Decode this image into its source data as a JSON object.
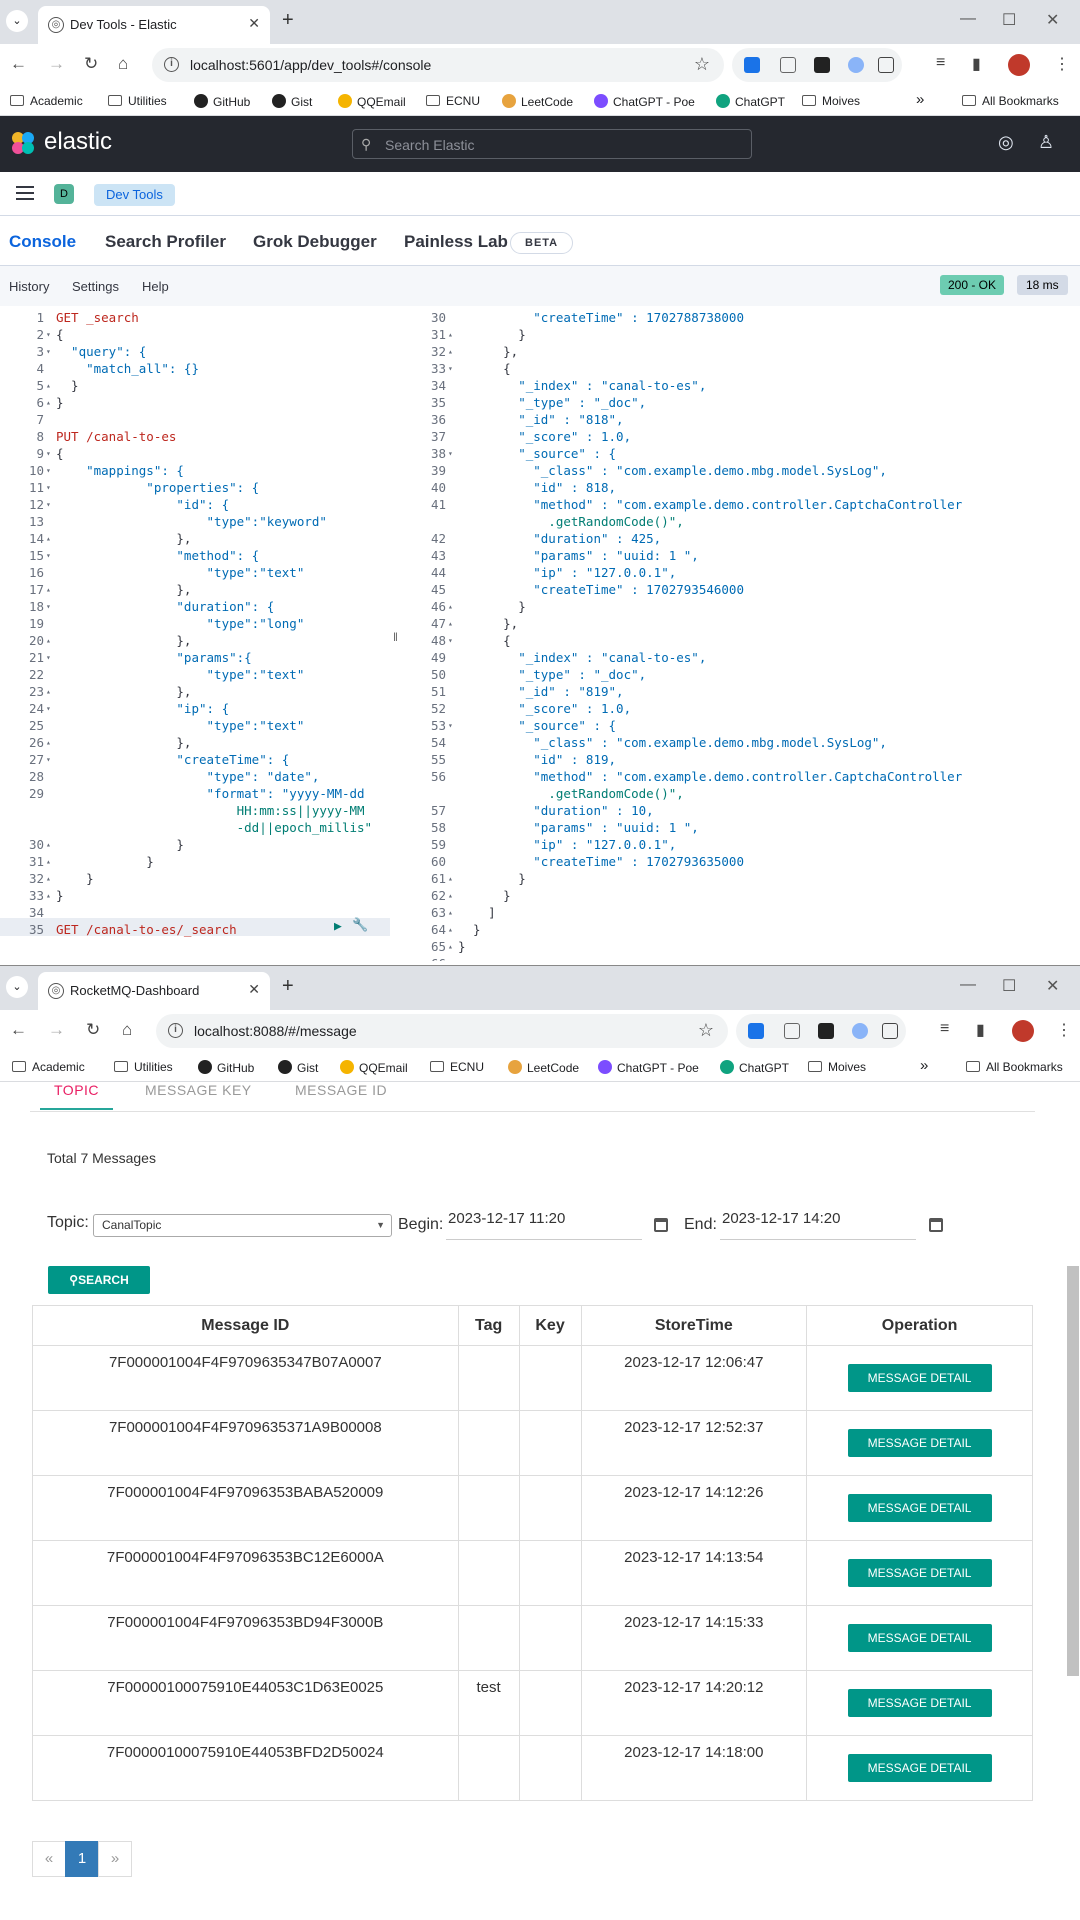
{
  "browser1": {
    "tab_title": "Dev Tools - Elastic",
    "url": "localhost:5601/app/dev_tools#/console"
  },
  "browser2": {
    "tab_title": "RocketMQ-Dashboard",
    "url": "localhost:8088/#/message"
  },
  "bookmarks": [
    "Academic",
    "Utilities",
    "GitHub",
    "Gist",
    "QQEmail",
    "ECNU",
    "LeetCode",
    "ChatGPT - Poe",
    "ChatGPT",
    "Moives"
  ],
  "bookmarks_more": "»",
  "all_bookmarks": "All Bookmarks",
  "kibana": {
    "brand": "elastic",
    "search_placeholder": "Search Elastic",
    "space_initial": "D",
    "breadcrumb": "Dev Tools",
    "tabs": [
      "Console",
      "Search Profiler",
      "Grok Debugger",
      "Painless Lab"
    ],
    "beta": "BETA",
    "menu": [
      "History",
      "Settings",
      "Help"
    ],
    "status": "200 - OK",
    "time": "18 ms"
  },
  "editor_lines": [
    {
      "n": "1",
      "fold": "",
      "t": "GET _search"
    },
    {
      "n": "2",
      "fold": "▾",
      "t": "{"
    },
    {
      "n": "3",
      "fold": "▾",
      "t": "  \"query\": {"
    },
    {
      "n": "4",
      "fold": "",
      "t": "    \"match_all\": {}"
    },
    {
      "n": "5",
      "fold": "▴",
      "t": "  }"
    },
    {
      "n": "6",
      "fold": "▴",
      "t": "}"
    },
    {
      "n": "7",
      "fold": "",
      "t": ""
    },
    {
      "n": "8",
      "fold": "",
      "t": "PUT /canal-to-es"
    },
    {
      "n": "9",
      "fold": "▾",
      "t": "{"
    },
    {
      "n": "10",
      "fold": "▾",
      "t": "    \"mappings\": {"
    },
    {
      "n": "11",
      "fold": "▾",
      "t": "            \"properties\": {"
    },
    {
      "n": "12",
      "fold": "▾",
      "t": "                \"id\": {"
    },
    {
      "n": "13",
      "fold": "",
      "t": "                    \"type\":\"keyword\""
    },
    {
      "n": "14",
      "fold": "▴",
      "t": "                },"
    },
    {
      "n": "15",
      "fold": "▾",
      "t": "                \"method\": {"
    },
    {
      "n": "16",
      "fold": "",
      "t": "                    \"type\":\"text\""
    },
    {
      "n": "17",
      "fold": "▴",
      "t": "                },"
    },
    {
      "n": "18",
      "fold": "▾",
      "t": "                \"duration\": {"
    },
    {
      "n": "19",
      "fold": "",
      "t": "                    \"type\":\"long\""
    },
    {
      "n": "20",
      "fold": "▴",
      "t": "                },"
    },
    {
      "n": "21",
      "fold": "▾",
      "t": "                \"params\":{"
    },
    {
      "n": "22",
      "fold": "",
      "t": "                    \"type\":\"text\""
    },
    {
      "n": "23",
      "fold": "▴",
      "t": "                },"
    },
    {
      "n": "24",
      "fold": "▾",
      "t": "                \"ip\": {"
    },
    {
      "n": "25",
      "fold": "",
      "t": "                    \"type\":\"text\""
    },
    {
      "n": "26",
      "fold": "▴",
      "t": "                },"
    },
    {
      "n": "27",
      "fold": "▾",
      "t": "                \"createTime\": {"
    },
    {
      "n": "28",
      "fold": "",
      "t": "                    \"type\": \"date\","
    },
    {
      "n": "29",
      "fold": "",
      "t": "                    \"format\": \"yyyy-MM-dd"
    },
    {
      "n": "",
      "fold": "",
      "t": "                        HH:mm:ss||yyyy-MM"
    },
    {
      "n": "",
      "fold": "",
      "t": "                        -dd||epoch_millis\""
    },
    {
      "n": "30",
      "fold": "▴",
      "t": "                }"
    },
    {
      "n": "31",
      "fold": "▴",
      "t": "            }"
    },
    {
      "n": "32",
      "fold": "▴",
      "t": "    }"
    },
    {
      "n": "33",
      "fold": "▴",
      "t": "}"
    },
    {
      "n": "34",
      "fold": "",
      "t": ""
    },
    {
      "n": "35",
      "fold": "",
      "t": "GET /canal-to-es/_search"
    }
  ],
  "output_lines": [
    {
      "n": "30",
      "fold": "",
      "t": "          \"createTime\" : 1702788738000"
    },
    {
      "n": "31",
      "fold": "▴",
      "t": "        }"
    },
    {
      "n": "32",
      "fold": "▴",
      "t": "      },"
    },
    {
      "n": "33",
      "fold": "▾",
      "t": "      {"
    },
    {
      "n": "34",
      "fold": "",
      "t": "        \"_index\" : \"canal-to-es\","
    },
    {
      "n": "35",
      "fold": "",
      "t": "        \"_type\" : \"_doc\","
    },
    {
      "n": "36",
      "fold": "",
      "t": "        \"_id\" : \"818\","
    },
    {
      "n": "37",
      "fold": "",
      "t": "        \"_score\" : 1.0,"
    },
    {
      "n": "38",
      "fold": "▾",
      "t": "        \"_source\" : {"
    },
    {
      "n": "39",
      "fold": "",
      "t": "          \"_class\" : \"com.example.demo.mbg.model.SysLog\","
    },
    {
      "n": "40",
      "fold": "",
      "t": "          \"id\" : 818,"
    },
    {
      "n": "41",
      "fold": "",
      "t": "          \"method\" : \"com.example.demo.controller.CaptchaController"
    },
    {
      "n": "",
      "fold": "",
      "t": "            .getRandomCode()\","
    },
    {
      "n": "42",
      "fold": "",
      "t": "          \"duration\" : 425,"
    },
    {
      "n": "43",
      "fold": "",
      "t": "          \"params\" : \"uuid: 1 \","
    },
    {
      "n": "44",
      "fold": "",
      "t": "          \"ip\" : \"127.0.0.1\","
    },
    {
      "n": "45",
      "fold": "",
      "t": "          \"createTime\" : 1702793546000"
    },
    {
      "n": "46",
      "fold": "▴",
      "t": "        }"
    },
    {
      "n": "47",
      "fold": "▴",
      "t": "      },"
    },
    {
      "n": "48",
      "fold": "▾",
      "t": "      {"
    },
    {
      "n": "49",
      "fold": "",
      "t": "        \"_index\" : \"canal-to-es\","
    },
    {
      "n": "50",
      "fold": "",
      "t": "        \"_type\" : \"_doc\","
    },
    {
      "n": "51",
      "fold": "",
      "t": "        \"_id\" : \"819\","
    },
    {
      "n": "52",
      "fold": "",
      "t": "        \"_score\" : 1.0,"
    },
    {
      "n": "53",
      "fold": "▾",
      "t": "        \"_source\" : {"
    },
    {
      "n": "54",
      "fold": "",
      "t": "          \"_class\" : \"com.example.demo.mbg.model.SysLog\","
    },
    {
      "n": "55",
      "fold": "",
      "t": "          \"id\" : 819,"
    },
    {
      "n": "56",
      "fold": "",
      "t": "          \"method\" : \"com.example.demo.controller.CaptchaController"
    },
    {
      "n": "",
      "fold": "",
      "t": "            .getRandomCode()\","
    },
    {
      "n": "57",
      "fold": "",
      "t": "          \"duration\" : 10,"
    },
    {
      "n": "58",
      "fold": "",
      "t": "          \"params\" : \"uuid: 1 \","
    },
    {
      "n": "59",
      "fold": "",
      "t": "          \"ip\" : \"127.0.0.1\","
    },
    {
      "n": "60",
      "fold": "",
      "t": "          \"createTime\" : 1702793635000"
    },
    {
      "n": "61",
      "fold": "▴",
      "t": "        }"
    },
    {
      "n": "62",
      "fold": "▴",
      "t": "      }"
    },
    {
      "n": "63",
      "fold": "▴",
      "t": "    ]"
    },
    {
      "n": "64",
      "fold": "▴",
      "t": "  }"
    },
    {
      "n": "65",
      "fold": "▴",
      "t": "}"
    },
    {
      "n": "66",
      "fold": "",
      "t": ""
    }
  ],
  "rocket": {
    "tabs": [
      "TOPIC",
      "MESSAGE KEY",
      "MESSAGE ID"
    ],
    "total": "Total 7 Messages",
    "topic_label": "Topic:",
    "topic_value": "CanalTopic",
    "begin_label": "Begin:",
    "begin_value": "2023-12-17 11:20",
    "end_label": "End:",
    "end_value": "2023-12-17 14:20",
    "search_label": "SEARCH",
    "columns": [
      "Message ID",
      "Tag",
      "Key",
      "StoreTime",
      "Operation"
    ],
    "detail_label": "MESSAGE DETAIL",
    "rows": [
      {
        "id": "7F000001004F4F9709635347B07A0007",
        "tag": "",
        "key": "",
        "time": "2023-12-17 12:06:47"
      },
      {
        "id": "7F000001004F4F9709635371A9B00008",
        "tag": "",
        "key": "",
        "time": "2023-12-17 12:52:37"
      },
      {
        "id": "7F000001004F4F97096353BABA520009",
        "tag": "",
        "key": "",
        "time": "2023-12-17 14:12:26"
      },
      {
        "id": "7F000001004F4F97096353BC12E6000A",
        "tag": "",
        "key": "",
        "time": "2023-12-17 14:13:54"
      },
      {
        "id": "7F000001004F4F97096353BD94F3000B",
        "tag": "",
        "key": "",
        "time": "2023-12-17 14:15:33"
      },
      {
        "id": "7F00000100075910E44053C1D63E0025",
        "tag": "test",
        "key": "",
        "time": "2023-12-17 14:20:12"
      },
      {
        "id": "7F00000100075910E44053BFD2D50024",
        "tag": "",
        "key": "",
        "time": "2023-12-17 14:18:00"
      }
    ],
    "pager": [
      "«",
      "1",
      "»"
    ]
  },
  "colors": {
    "kibana_header": "#25282f",
    "kibana_blue": "#0b64dd",
    "teal": "#009688",
    "topic_pink": "#e91e63",
    "pager_blue": "#337ab7"
  }
}
